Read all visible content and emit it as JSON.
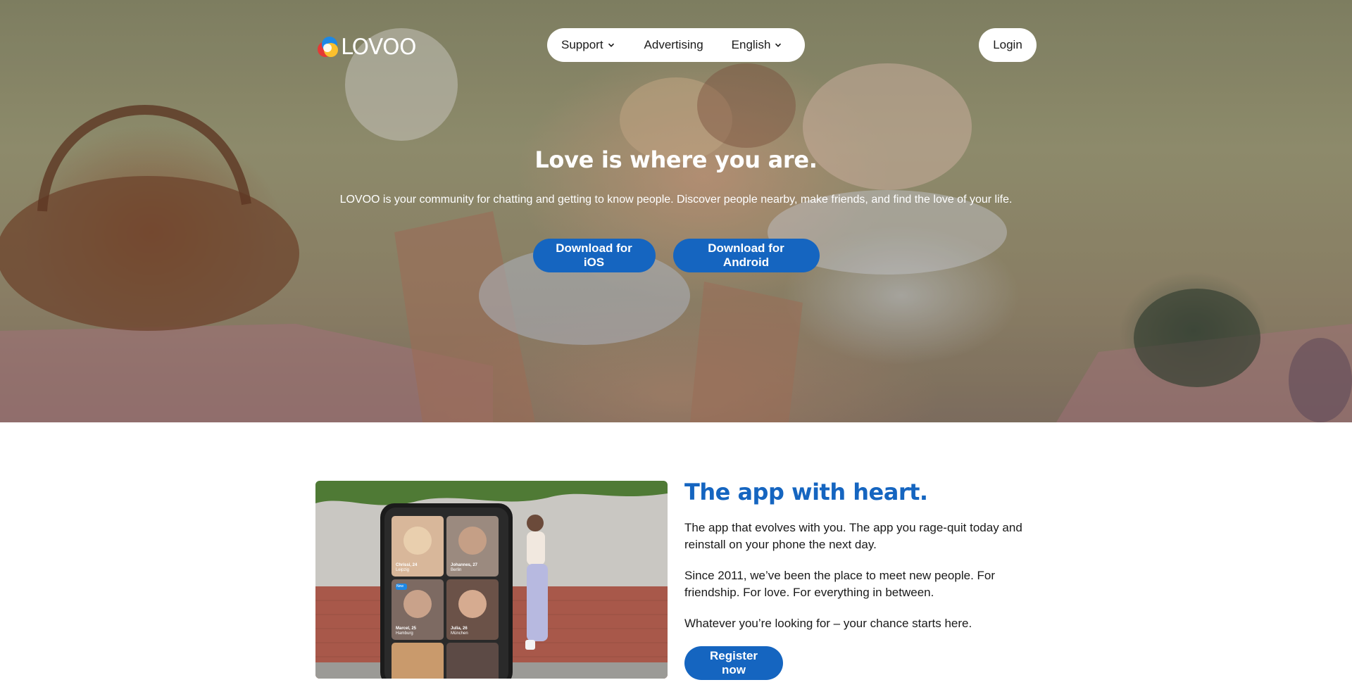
{
  "header": {
    "logo_text": "LOVOO",
    "nav": {
      "support_label": "Support",
      "advertising_label": "Advertising",
      "language_label": "English"
    },
    "login_label": "Login"
  },
  "hero": {
    "title": "Love is where you are.",
    "description": "LOVOO is your community for chatting and getting to know people. Discover people nearby, make friends, and find the love of your life.",
    "ios_button_label": "Download for iOS",
    "android_button_label": "Download for Android"
  },
  "feature": {
    "title": "The app with heart.",
    "paragraphs": [
      "The app that evolves with you. The app you rage-quit today and reinstall on your phone the next day.",
      "Since 2011, we’ve been the place to meet new people. For friendship. For love. For everything in between.",
      "Whatever you’re looking for – your chance starts here."
    ],
    "register_label": "Register now",
    "phone_profiles": [
      {
        "name": "Chrissi, 24",
        "city": "Leipzig"
      },
      {
        "name": "Johannes, 27",
        "city": "Berlin"
      },
      {
        "name": "Marcel, 25",
        "city": "Hamburg"
      },
      {
        "name": "Julia, 26",
        "city": "München"
      }
    ],
    "phone_new_badge": "New"
  },
  "colors": {
    "brand_blue": "#1565c0",
    "white": "#ffffff",
    "text_dark": "#1a1a1a"
  }
}
